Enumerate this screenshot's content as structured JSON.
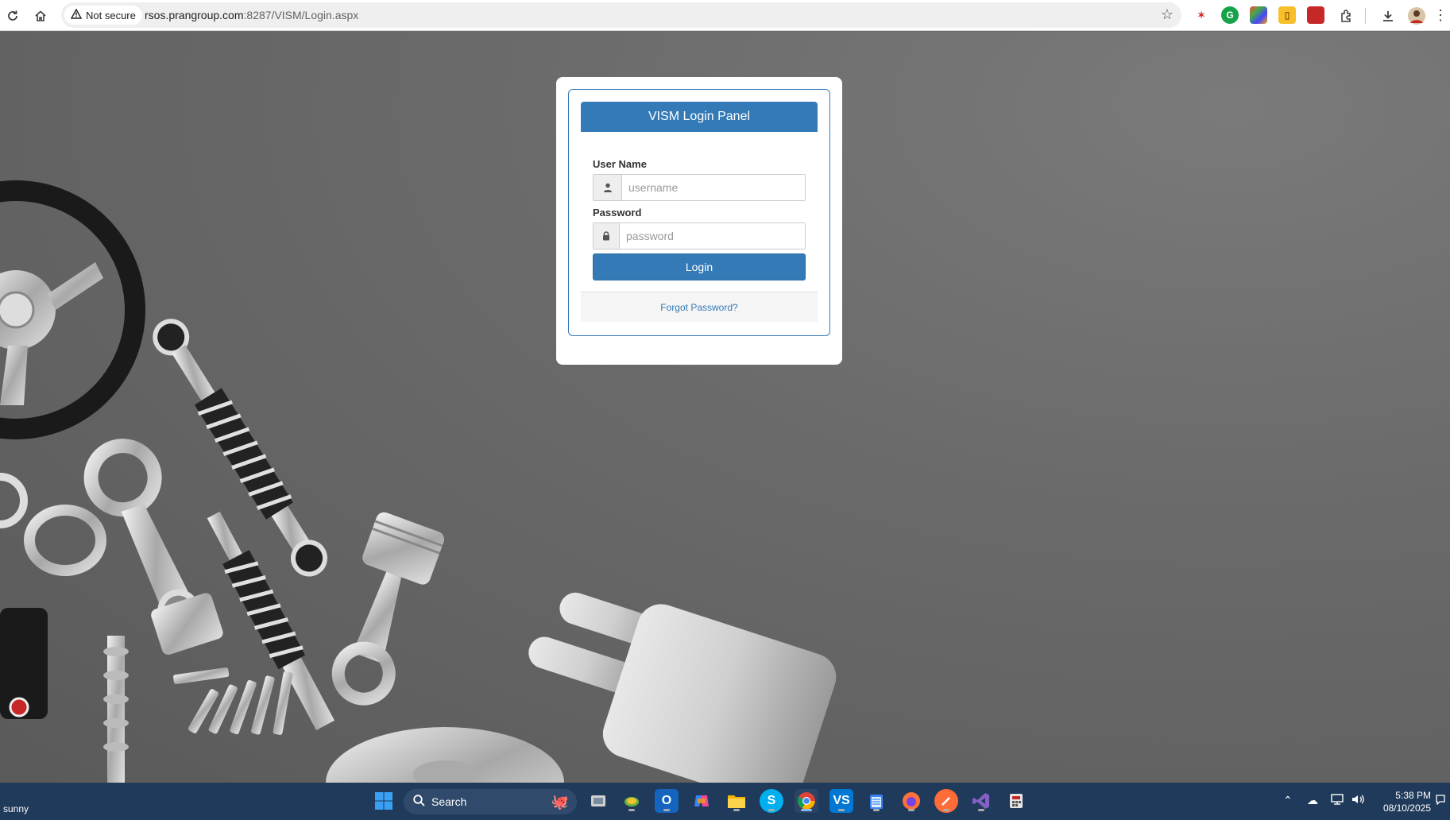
{
  "browser": {
    "security_label": "Not secure",
    "url_host": "rsos.prangroup.com",
    "url_path": ":8287/VISM/Login.aspx",
    "icons": [
      "reload-icon",
      "home-icon",
      "warning-icon",
      "star-icon",
      "extensions-icon",
      "download-icon",
      "menu-icon"
    ]
  },
  "login_panel": {
    "title": "VISM Login Panel",
    "username_label": "User Name",
    "username_placeholder": "username",
    "username_value": "",
    "password_label": "Password",
    "password_placeholder": "password",
    "password_value": "",
    "login_button": "Login",
    "forgot_link": "Forgot Password?"
  },
  "colors": {
    "primary": "#337ab7",
    "taskbar": "#1f3a5a",
    "background": "#6a6a6a"
  },
  "taskbar": {
    "weather_text": "sunny",
    "search_label": "Search",
    "time": "5:38 PM",
    "date": "08/10/2025"
  }
}
